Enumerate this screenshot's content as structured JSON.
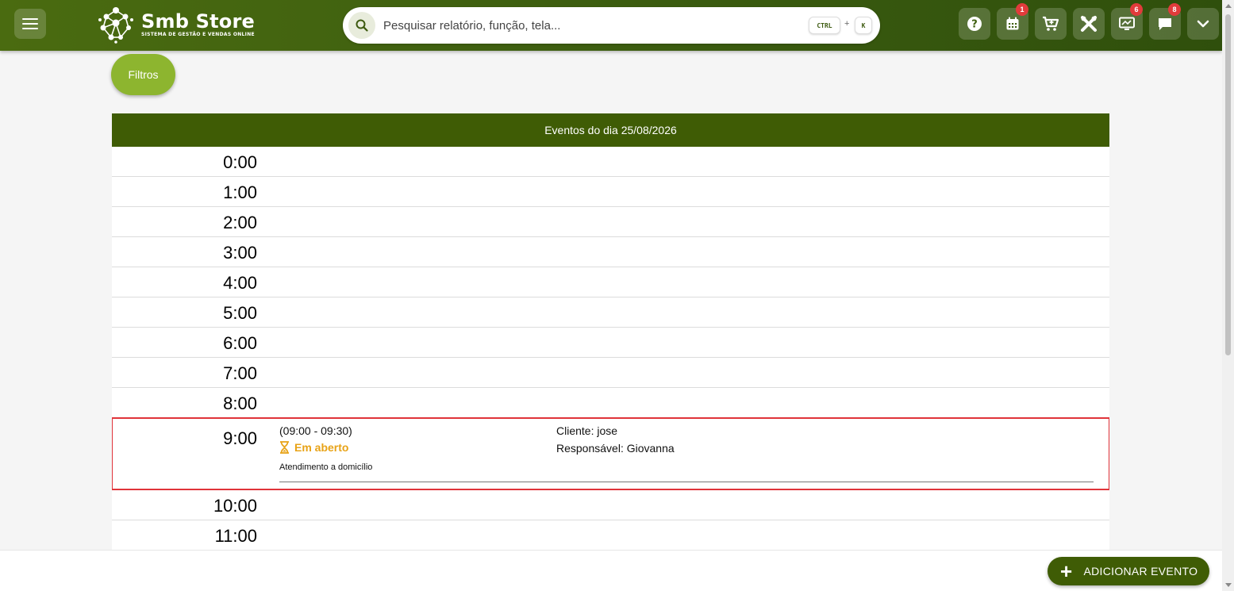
{
  "header": {
    "brand": "Smb Store",
    "brand_subtitle": "SISTEMA DE GESTÃO E VENDAS ONLINE",
    "search_placeholder": "Pesquisar relatório, função, tela...",
    "shortcut_ctrl": "CTRL",
    "shortcut_plus": "+",
    "shortcut_k": "K",
    "actions": [
      {
        "icon": "help-icon",
        "badge": ""
      },
      {
        "icon": "calendar-icon",
        "badge": "1"
      },
      {
        "icon": "cart-icon",
        "badge": ""
      },
      {
        "icon": "tools-icon",
        "badge": ""
      },
      {
        "icon": "monitor-icon",
        "badge": "6"
      },
      {
        "icon": "chat-icon",
        "badge": "8"
      },
      {
        "icon": "chevron-down-icon",
        "badge": ""
      }
    ]
  },
  "filters_label": "Filtros",
  "agenda": {
    "title": "Eventos do dia 25/08/2026",
    "hours": [
      "0:00",
      "1:00",
      "2:00",
      "3:00",
      "4:00",
      "5:00",
      "6:00",
      "7:00",
      "8:00",
      "9:00",
      "10:00",
      "11:00"
    ],
    "event": {
      "hour": "9:00",
      "time_range": "(09:00 - 09:30)",
      "status": "Em aberto",
      "description": "Atendimento a domicílio",
      "client": "Cliente: jose",
      "responsible": "Responsável: Giovanna"
    }
  },
  "add_event_label": "ADICIONAR EVENTO",
  "colors": {
    "header_green": "#3f6010",
    "accent_green": "#3f5c05",
    "filter_green": "#8db52f",
    "status_open": "#e8a317",
    "highlight_red": "#e0343a",
    "badge_red": "#e23b3b"
  }
}
